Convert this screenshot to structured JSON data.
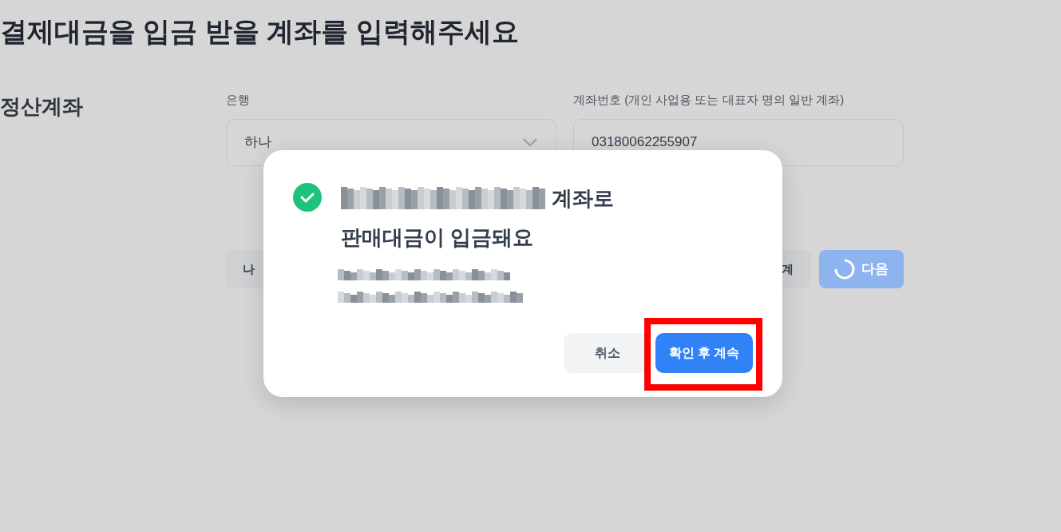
{
  "page": {
    "heading": "결제대금을 입금 받을 계좌를 입력해주세요",
    "section_label": "정산계좌",
    "bank": {
      "label": "은행",
      "value": "하나"
    },
    "account": {
      "label": "계좌번호 (개인 사업용 또는 대표자 명의 일반 계좌)",
      "value": "03180062255907"
    },
    "buttons": [
      {
        "kind": "secondary",
        "label": "나"
      },
      {
        "kind": "secondary",
        "label": "계"
      },
      {
        "kind": "primary",
        "label": "다음",
        "loading": true
      }
    ]
  },
  "dialog": {
    "title_line1_end": "계좌로",
    "title_line2": "판매대금이 입금돼요",
    "buttons": [
      {
        "kind": "secondary",
        "label": "취소"
      },
      {
        "kind": "primary",
        "label": "확인 후 계속",
        "highlighted": true
      }
    ]
  }
}
